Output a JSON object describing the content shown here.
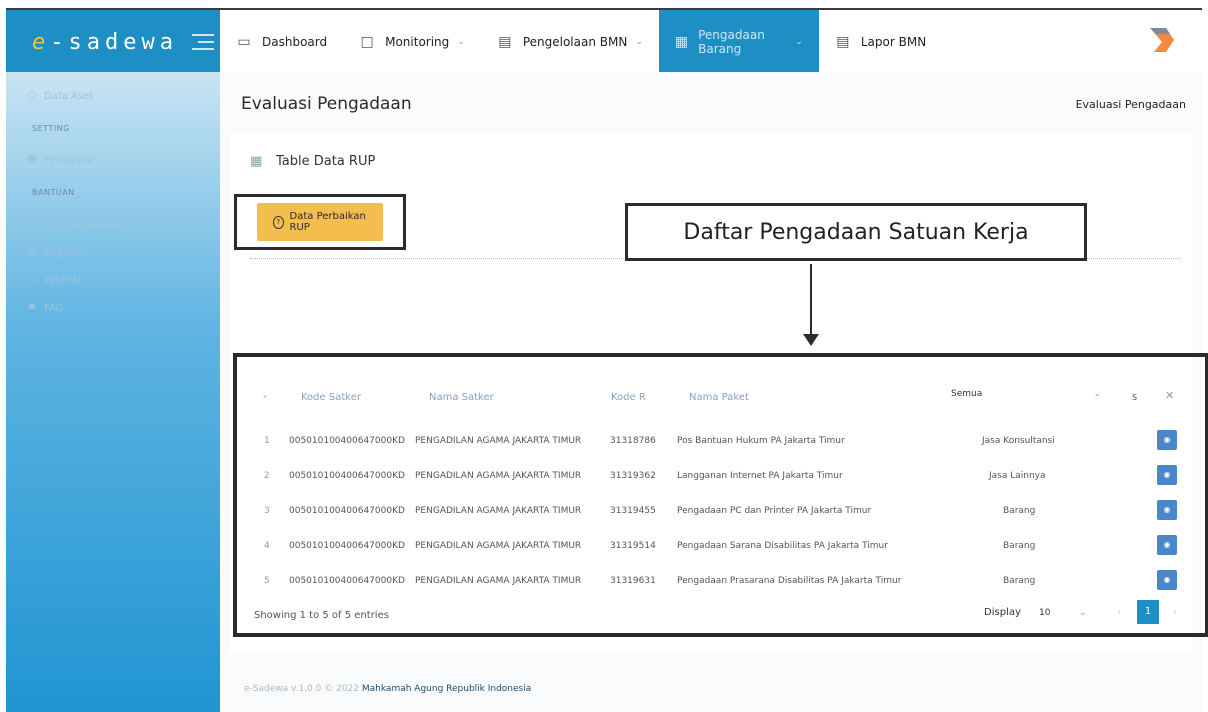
{
  "brand": {
    "e": "e",
    "rest": "-sadewa"
  },
  "nav": [
    {
      "label": "Dashboard",
      "icon": "monitor-icon",
      "chevron": false
    },
    {
      "label": "Monitoring",
      "icon": "calendar-icon",
      "chevron": true
    },
    {
      "label": "Pengelolaan BMN",
      "icon": "document-icon",
      "chevron": true
    },
    {
      "label": "Pengadaan Barang",
      "icon": "building-icon",
      "chevron": true,
      "active": true
    },
    {
      "label": "Lapor BMN",
      "icon": "report-icon",
      "chevron": false
    }
  ],
  "sidebar": {
    "data_aset": "Data Aset",
    "setting_head": "SETTING",
    "pengguna": "Pengguna",
    "bantuan_head": "BANTUAN",
    "tentang": "Tentang Aplikasi",
    "regulasi": "Regulasi",
    "tutorial": "Tutorial",
    "faq": "FAQ"
  },
  "page": {
    "title": "Evaluasi Pengadaan",
    "breadcrumb": "Evaluasi Pengadaan"
  },
  "card": {
    "title": "Table Data RUP",
    "button": "Data Perbaikan RUP"
  },
  "callout": "Daftar Pengadaan Satuan Kerja",
  "table": {
    "headers": {
      "kode_satker": "Kode Satker",
      "nama_satker": "Nama Satker",
      "kode_r": "Kode R",
      "nama_paket": "Nama Paket",
      "filter": "Semua",
      "s": "S"
    },
    "rows": [
      {
        "no": "1",
        "kode_satker": "005010100400647000KD",
        "nama_satker": "PENGADILAN AGAMA JAKARTA TIMUR",
        "kode": "31318786",
        "paket": "Pos Bantuan Hukum PA Jakarta Timur",
        "jenis": "Jasa Konsultansi"
      },
      {
        "no": "2",
        "kode_satker": "005010100400647000KD",
        "nama_satker": "PENGADILAN AGAMA JAKARTA TIMUR",
        "kode": "31319362",
        "paket": "Langganan Internet PA Jakarta Timur",
        "jenis": "Jasa Lainnya"
      },
      {
        "no": "3",
        "kode_satker": "005010100400647000KD",
        "nama_satker": "PENGADILAN AGAMA JAKARTA TIMUR",
        "kode": "31319455",
        "paket": "Pengadaan PC dan Printer PA Jakarta Timur",
        "jenis": "Barang"
      },
      {
        "no": "4",
        "kode_satker": "005010100400647000KD",
        "nama_satker": "PENGADILAN AGAMA JAKARTA TIMUR",
        "kode": "31319514",
        "paket": "Pengadaan Sarana Disabilitas PA Jakarta Timur",
        "jenis": "Barang"
      },
      {
        "no": "5",
        "kode_satker": "005010100400647000KD",
        "nama_satker": "PENGADILAN AGAMA JAKARTA TIMUR",
        "kode": "31319631",
        "paket": "Pengadaan Prasarana Disabilitas PA Jakarta Timur",
        "jenis": "Barang"
      }
    ],
    "info": "Showing 1 to 5 of 5 entries",
    "display_label": "Display",
    "display_value": "10",
    "page": "1"
  },
  "footer": {
    "version": "e-Sadewa v.1.0.0 © 2022",
    "org": "Mahkamah Agung Republik Indonesia"
  },
  "colors": {
    "primary": "#1e8fc4",
    "button": "#f4be4e",
    "eye": "#4a86c8"
  }
}
